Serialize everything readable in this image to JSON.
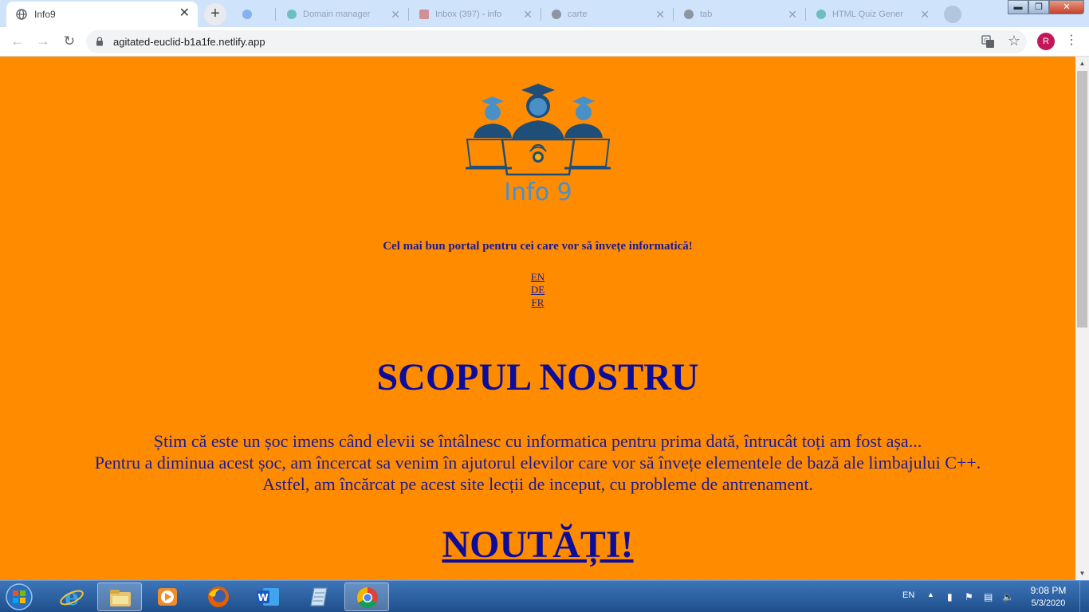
{
  "browser": {
    "active_tab": {
      "title": "Info9",
      "icon": "globe-icon"
    },
    "background_tabs": [
      {
        "title": "",
        "icon": "chrome-icon",
        "color": "#4b8de0"
      },
      {
        "title": "Domain manager",
        "icon": "netlify-icon",
        "color": "#1f9e8f"
      },
      {
        "title": "Inbox (397) - info",
        "icon": "mail-icon",
        "color": "#d44c3f"
      },
      {
        "title": "carte",
        "icon": "github-icon",
        "color": "#555555"
      },
      {
        "title": "tab",
        "icon": "github-icon",
        "color": "#555555"
      },
      {
        "title": "HTML Quiz Gener",
        "icon": "netlify-icon",
        "color": "#1f9e8f"
      }
    ],
    "new_tab_label": "+",
    "close_label": "✕",
    "url": "agitated-euclid-b1a1fe.netlify.app",
    "profile_initial": "R"
  },
  "page": {
    "logo_text": "Info 9",
    "tagline": "Cel mai bun portal pentru cei care vor să învețe informatică!",
    "languages": [
      "EN",
      "DE",
      "FR"
    ],
    "purpose_heading": "SCOPUL NOSTRU",
    "purpose_lines": [
      "Știm că este un șoc imens când elevii se întâlnesc cu informatica pentru prima dată, întrucât toți am fost așa...",
      "Pentru a diminua acest șoc, am încercat sa venim în ajutorul elevilor care vor să învețe elementele de bază ale limbajului C++.",
      "Astfel, am încărcat pe acest site lecții de inceput, cu probleme de antrenament."
    ],
    "news_heading": "NOUTĂȚI!",
    "background_color": "#ff8c00",
    "text_color": "#1a1a9a"
  },
  "taskbar": {
    "language": "EN",
    "time": "9:08 PM",
    "date": "5/3/2020",
    "apps": [
      "internet-explorer-icon",
      "file-explorer-icon",
      "media-player-icon",
      "firefox-icon",
      "word-icon",
      "notepad-icon",
      "chrome-icon"
    ]
  }
}
